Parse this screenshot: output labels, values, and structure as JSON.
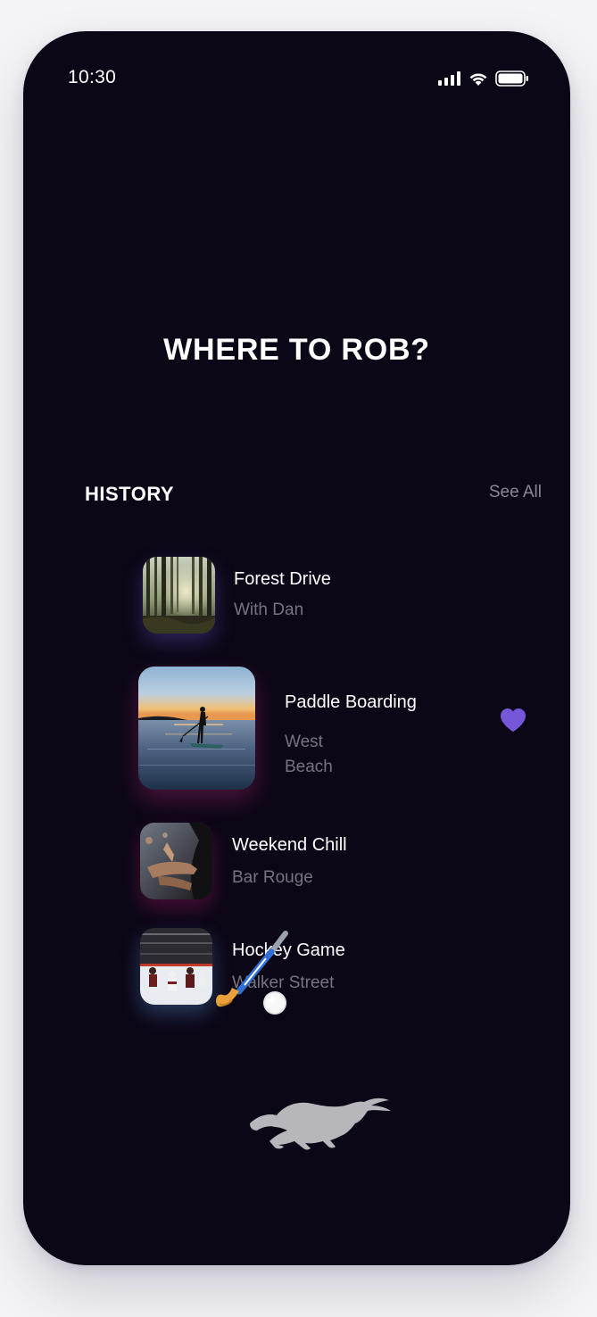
{
  "status_bar": {
    "time": "10:30",
    "icons": [
      "signal-icon",
      "wifi-icon",
      "battery-icon"
    ]
  },
  "header": {
    "title": "WHERE TO ROB?"
  },
  "history": {
    "label": "HISTORY",
    "see_all": "See All",
    "items": [
      {
        "title": "Forest Drive",
        "subtitle": "With Dan",
        "image": "forest-thumbnail",
        "favorite": false
      },
      {
        "title": "Paddle Boarding",
        "subtitle_line1": "West",
        "subtitle_line2": "Beach",
        "image": "paddle-board-thumbnail",
        "favorite": true
      },
      {
        "title": "Weekend Chill",
        "subtitle": "Bar Rouge",
        "image": "car-window-thumbnail",
        "favorite": false
      },
      {
        "title": "Hockey Game",
        "subtitle": "Walker Street",
        "image": "hockey-thumbnail",
        "favorite": false
      }
    ]
  },
  "decorations": [
    "hockey-stick-emoji",
    "mustang-logo"
  ],
  "colors": {
    "background": "#0c0717",
    "text_primary": "#ffffff",
    "text_secondary": "#77737f",
    "accent_heart": "#7657d9",
    "logo": "#b7b6ba"
  }
}
